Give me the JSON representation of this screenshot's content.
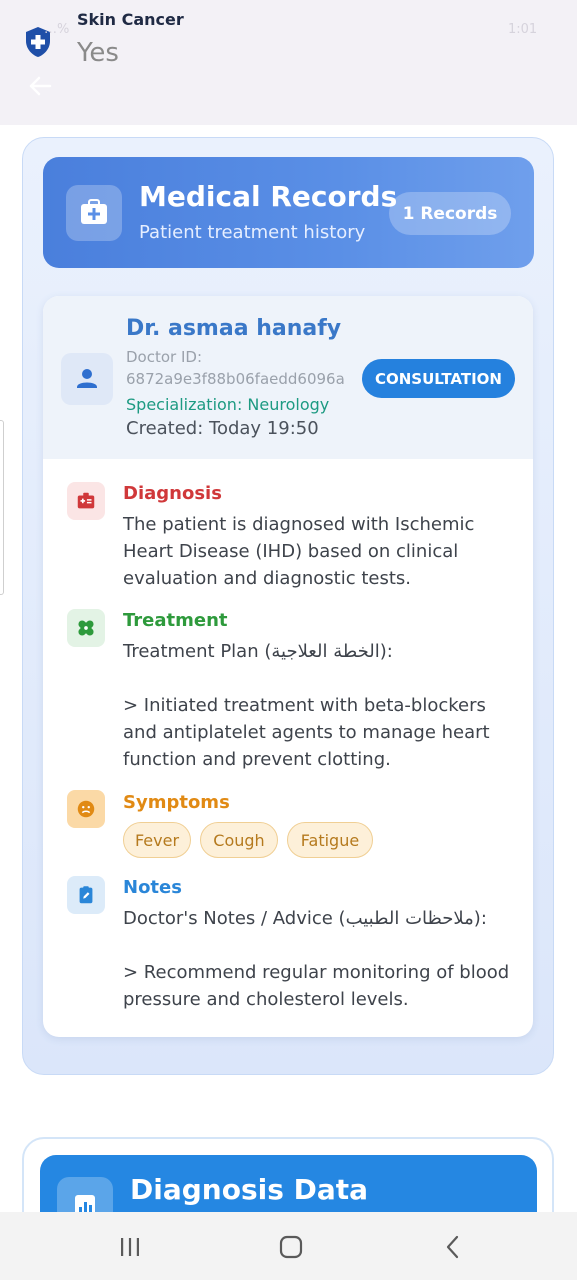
{
  "app_bar": {
    "title": "Skin Cancer",
    "subtitle": "Yes",
    "status_left": "…%",
    "status_right": "1:01"
  },
  "header": {
    "title": "Medical Records",
    "subtitle": "Patient treatment history",
    "records_badge": "1 Records"
  },
  "record": {
    "doctor_name": "Dr. asmaa hanafy",
    "doctor_id_label": "Doctor ID:",
    "doctor_id": "6872a9e3f88b06faedd6096a",
    "specialization": "Specialization: Neurology",
    "created": "Created: Today 19:50",
    "type_button": "CONSULTATION",
    "diagnosis": {
      "title": "Diagnosis",
      "body": "The patient is diagnosed with Ischemic Heart Disease (IHD) based on clinical evaluation and diagnostic tests."
    },
    "treatment": {
      "title": "Treatment",
      "body": "Treatment Plan (الخطة العلاجية):\n\n> Initiated treatment with beta-blockers and antiplatelet agents to manage heart function and prevent clotting."
    },
    "symptoms": {
      "title": "Symptoms",
      "items": [
        "Fever",
        "Cough",
        "Fatigue"
      ]
    },
    "notes": {
      "title": "Notes",
      "body": "Doctor's Notes / Advice (ملاحظات الطبيب):\n\n> Recommend regular monitoring of blood pressure and cholesterol levels."
    }
  },
  "diagnosis_data": {
    "title": "Diagnosis Data"
  },
  "colors": {
    "header_blue": "#4a7fdc",
    "consult_blue": "#2581de",
    "diagnosis_red": "#d0383a",
    "treatment_green": "#2e9a3c",
    "symptoms_orange": "#e18a14",
    "notes_blue": "#2a86d8"
  },
  "icons": {
    "app": "shield-plus-icon",
    "back": "arrow-left-icon",
    "header": "medical-kit-icon",
    "doctor": "person-icon",
    "diagnosis": "medical-id-icon",
    "treatment": "bandage-icon",
    "symptoms": "sick-face-icon",
    "notes": "edit-note-icon",
    "diagnosis_data": "bar-chart-icon"
  }
}
